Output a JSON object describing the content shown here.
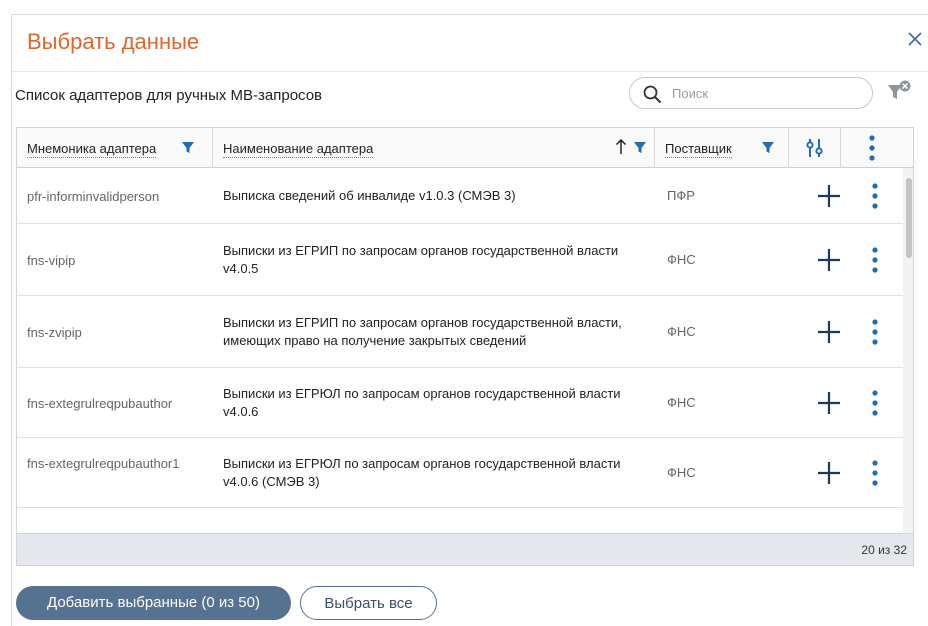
{
  "dialog": {
    "title": "Выбрать данные",
    "close_icon": "close-icon",
    "accent_color": "#e0662c"
  },
  "toolbar": {
    "list_title": "Список адаптеров для ручных МВ-запросов",
    "search_placeholder": "Поиск",
    "search_value": ""
  },
  "table": {
    "columns": [
      {
        "label": "Мнемоника адаптера",
        "icons": [
          "filter-icon"
        ]
      },
      {
        "label": "Наименование адаптера",
        "icons": [
          "sort-asc-icon",
          "filter-icon"
        ]
      },
      {
        "label": "Поставщик",
        "icons": [
          "filter-icon"
        ]
      },
      {
        "label": "",
        "icons": [
          "column-settings-icon"
        ]
      },
      {
        "label": "",
        "icons": [
          "more-vertical-icon"
        ]
      }
    ],
    "rows": [
      {
        "mnemonic": "pfr-informinvalidperson",
        "name": "Выписка сведений об инвалиде v1.0.3 (СМЭВ 3)",
        "supplier": "ПФР"
      },
      {
        "mnemonic": "fns-vipip",
        "name": "Выписки из ЕГРИП по запросам органов государственной власти v4.0.5",
        "supplier": "ФНС"
      },
      {
        "mnemonic": "fns-zvipip",
        "name": "Выписки из ЕГРИП по запросам органов государственной власти, имеющих право на получение закрытых сведений",
        "supplier": "ФНС"
      },
      {
        "mnemonic": "fns-extegrulreqpubauthor",
        "name": "Выписки из ЕГРЮЛ по запросам органов государственной власти v4.0.6",
        "supplier": "ФНС"
      },
      {
        "mnemonic": "fns-extegrulreqpubauthor1",
        "name": "Выписки из ЕГРЮЛ по запросам органов государственной власти v4.0.6 (СМЭВ 3)",
        "supplier": "ФНС"
      }
    ],
    "count": "20 из 32",
    "accent_color": "#1f6eb4"
  },
  "actions": {
    "add_selected_label": "Добавить выбранные (0 из 50)",
    "select_all_label": "Выбрать все",
    "primary_color": "#557290"
  }
}
